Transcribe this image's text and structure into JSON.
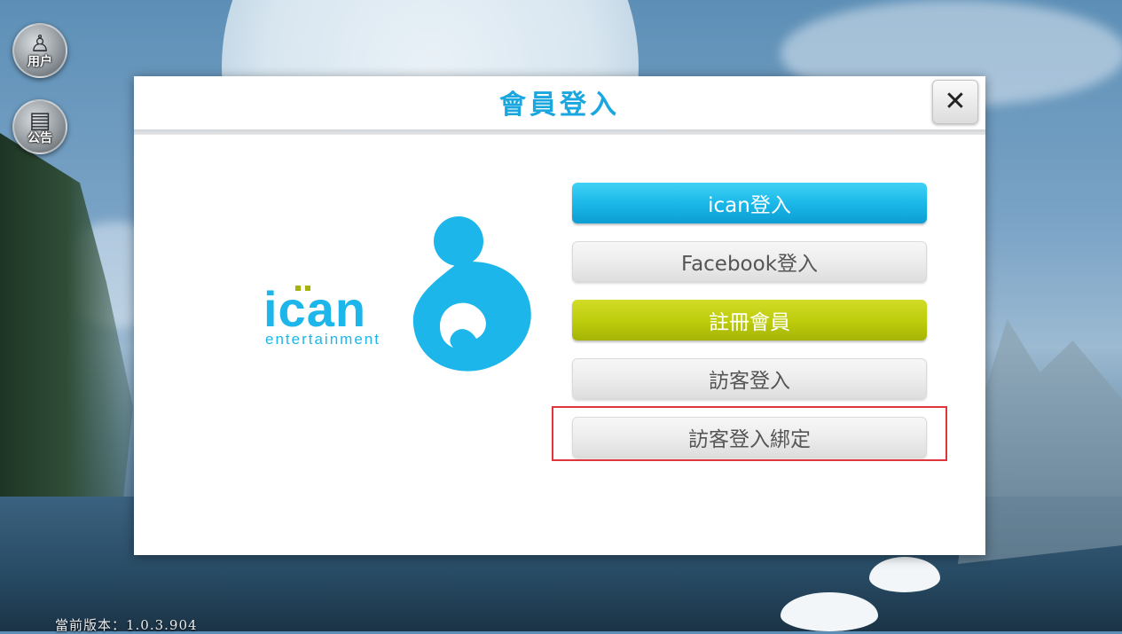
{
  "dialog": {
    "title": "會員登入",
    "close_glyph": "✕"
  },
  "logo": {
    "brand": "ican",
    "tagline": "entertainment",
    "brand_color": "#1db6ea",
    "accent_color": "#a5b40d"
  },
  "buttons": [
    {
      "label": "ican登入",
      "style": "blue"
    },
    {
      "label": "Facebook登入",
      "style": "grey"
    },
    {
      "label": "註冊會員",
      "style": "green"
    },
    {
      "label": "訪客登入",
      "style": "grey"
    },
    {
      "label": "訪客登入綁定",
      "style": "grey",
      "highlighted": true
    }
  ],
  "side_menu": [
    {
      "label": "用户",
      "icon": "user-icon"
    },
    {
      "label": "公告",
      "icon": "notice-board-icon"
    }
  ],
  "version": "當前版本：1.0.3.904",
  "colors": {
    "title": "#1aa6df",
    "blue_button": "#1ab8e8",
    "green_button": "#bccb0b",
    "highlight_border": "#e0353a"
  }
}
